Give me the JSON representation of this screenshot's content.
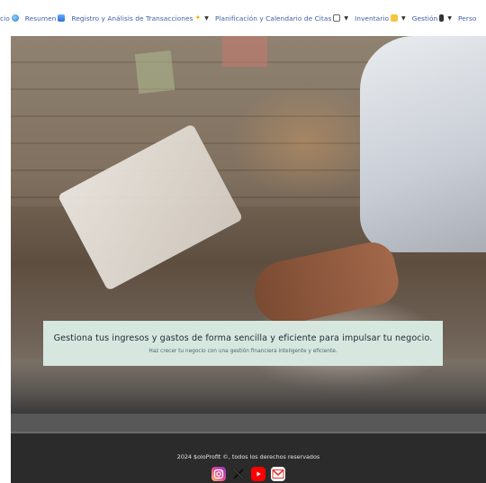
{
  "nav": {
    "items": [
      {
        "label": "cio",
        "icon": "globe-icon",
        "dropdown": false
      },
      {
        "label": "Resumen",
        "icon": "bar-chart-icon",
        "dropdown": false
      },
      {
        "label": "Registro y Análisis de Transacciones",
        "icon": "sparkles-icon",
        "dropdown": true
      },
      {
        "label": "Planificación y Calendario de Citas",
        "icon": "calendar-icon",
        "dropdown": true
      },
      {
        "label": "Inventario",
        "icon": "box-icon",
        "dropdown": true
      },
      {
        "label": "Gestión",
        "icon": "phone-icon",
        "dropdown": true
      },
      {
        "label": "Perso",
        "icon": "",
        "dropdown": false
      }
    ]
  },
  "hero": {
    "title": "Gestiona tus ingresos y gastos de forma sencilla y eficiente para impulsar tu negocio.",
    "subtitle": "Haz crecer tu negocio con una gestión financiera inteligente y eficiente."
  },
  "footer": {
    "copyright": "2024 $oloProfit ©, todos los derechos reservados",
    "socials": [
      {
        "name": "instagram",
        "icon": "instagram-icon",
        "color": "#d6249f"
      },
      {
        "name": "x",
        "icon": "x-icon",
        "color": "#000000"
      },
      {
        "name": "youtube",
        "icon": "youtube-icon",
        "color": "#ff0000"
      },
      {
        "name": "email",
        "icon": "mail-icon",
        "color": "#e53935"
      }
    ]
  },
  "colors": {
    "nav_text": "#3f5ea8",
    "banner_bg": "#d6e7df",
    "footer_bg": "#2b2b2b"
  }
}
